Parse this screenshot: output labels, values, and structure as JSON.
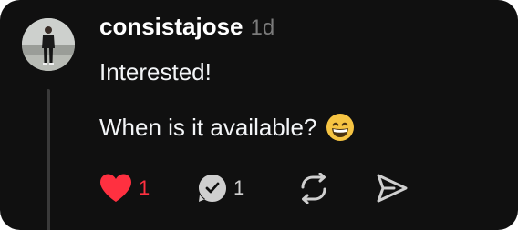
{
  "post": {
    "username": "consistajose",
    "timestamp": "1d",
    "line1": "Interested!",
    "line2": "When is it available?",
    "emoji": "grinning-face-with-smiling-eyes"
  },
  "actions": {
    "like_count": "1",
    "reply_count": "1"
  },
  "colors": {
    "background": "#101010",
    "text": "#f3f5f7",
    "muted": "#7a7a7a",
    "like": "#ff3040",
    "icon": "#cfcfcf"
  }
}
